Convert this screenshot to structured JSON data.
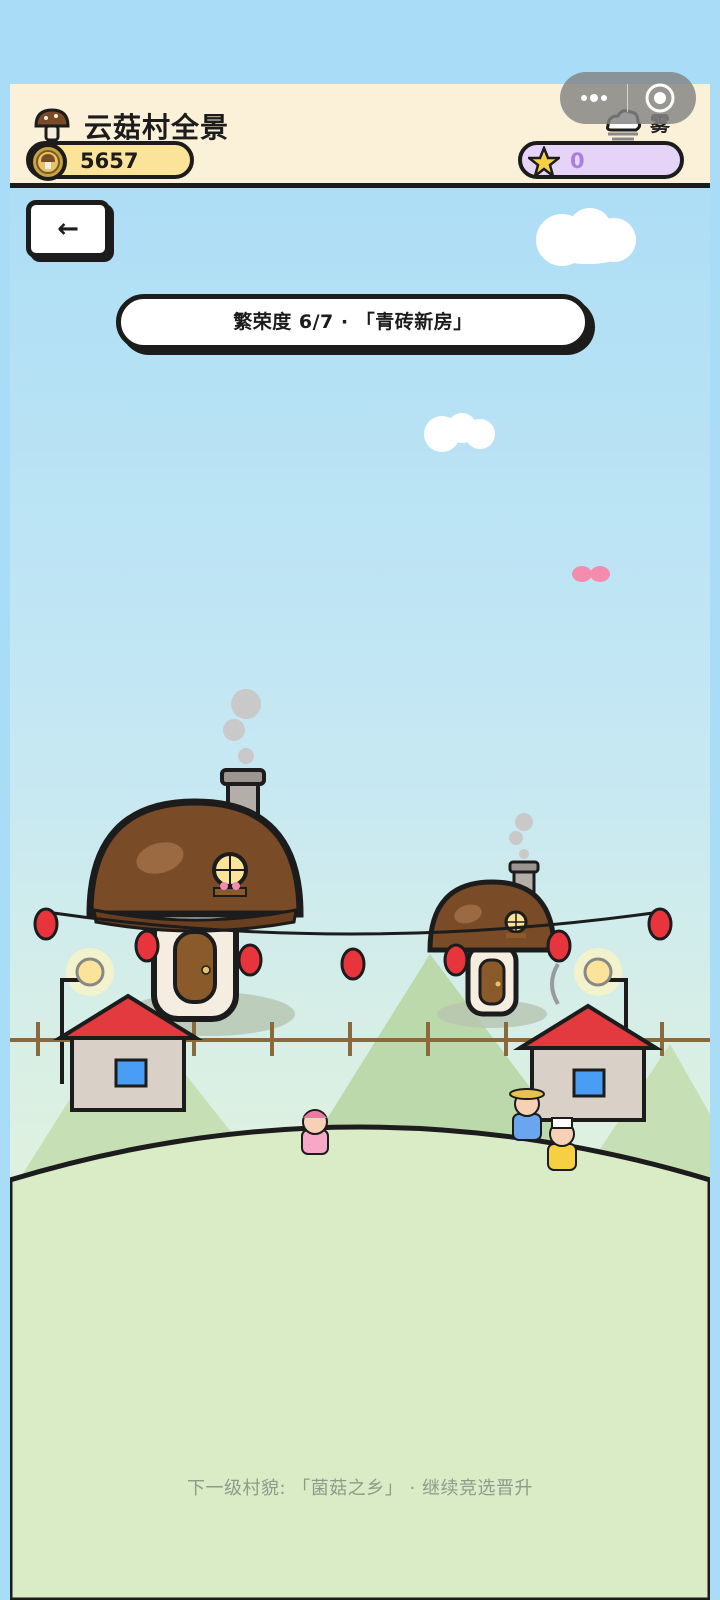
{
  "header": {
    "title": "云菇村全景",
    "coins": "5657",
    "stars": "0",
    "weather_label": "雾",
    "weather_icon": "fog-cloud-icon"
  },
  "nav": {
    "back_label": "←"
  },
  "banner": {
    "text": "繁荣度 6/7 · 「青砖新房」"
  },
  "footer": {
    "hint": "下一级村貌: 「菌菇之乡」 · 继续竞选晋升"
  },
  "colors": {
    "header_bg": "#fbf1d8",
    "coin_pill": "#fbe49a",
    "star_pill": "#e6d4f8",
    "star_value": "#a87fe0",
    "mushroom_cap": "#7a4b27",
    "roof": "#e33a3f",
    "lantern": "#e8343c",
    "hill": "#d9ecc6"
  }
}
